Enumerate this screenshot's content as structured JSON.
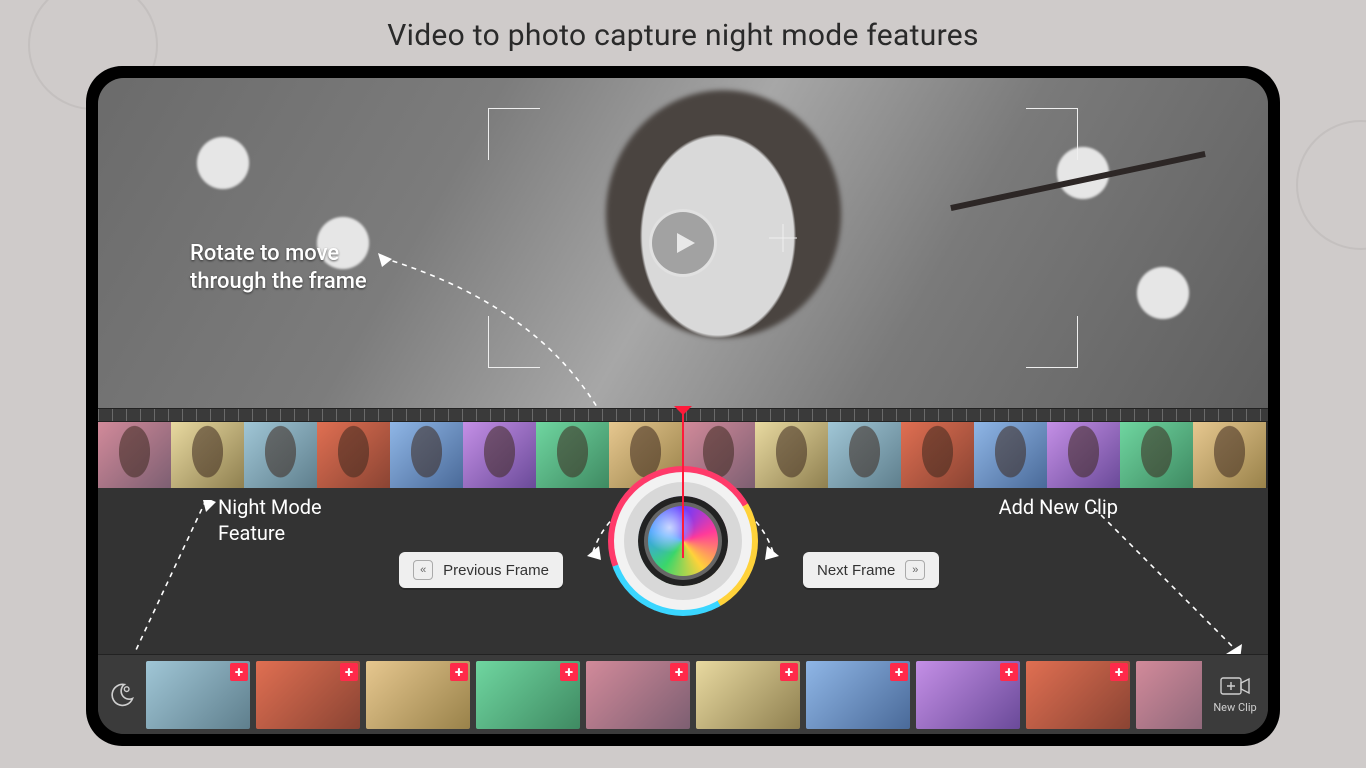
{
  "title": "Video to photo capture night mode features",
  "annotations": {
    "rotate_l1": "Rotate to move",
    "rotate_l2": "through the frame",
    "night_l1": "Night Mode",
    "night_l2": "Feature",
    "add_clip": "Add New Clip"
  },
  "controls": {
    "prev": "Previous Frame",
    "next": "Next Frame",
    "new_clip": "New Clip"
  },
  "icons": {
    "play": "play-icon",
    "night": "moon-gear-icon",
    "add": "+",
    "new_clip": "video-add-icon",
    "chev_left": "«",
    "chev_right": "»"
  },
  "timeline": {
    "count": 16
  },
  "clips": {
    "count": 10
  },
  "colors": {
    "playhead": "#ff1a3a",
    "add_badge": "#ff2a4a"
  }
}
